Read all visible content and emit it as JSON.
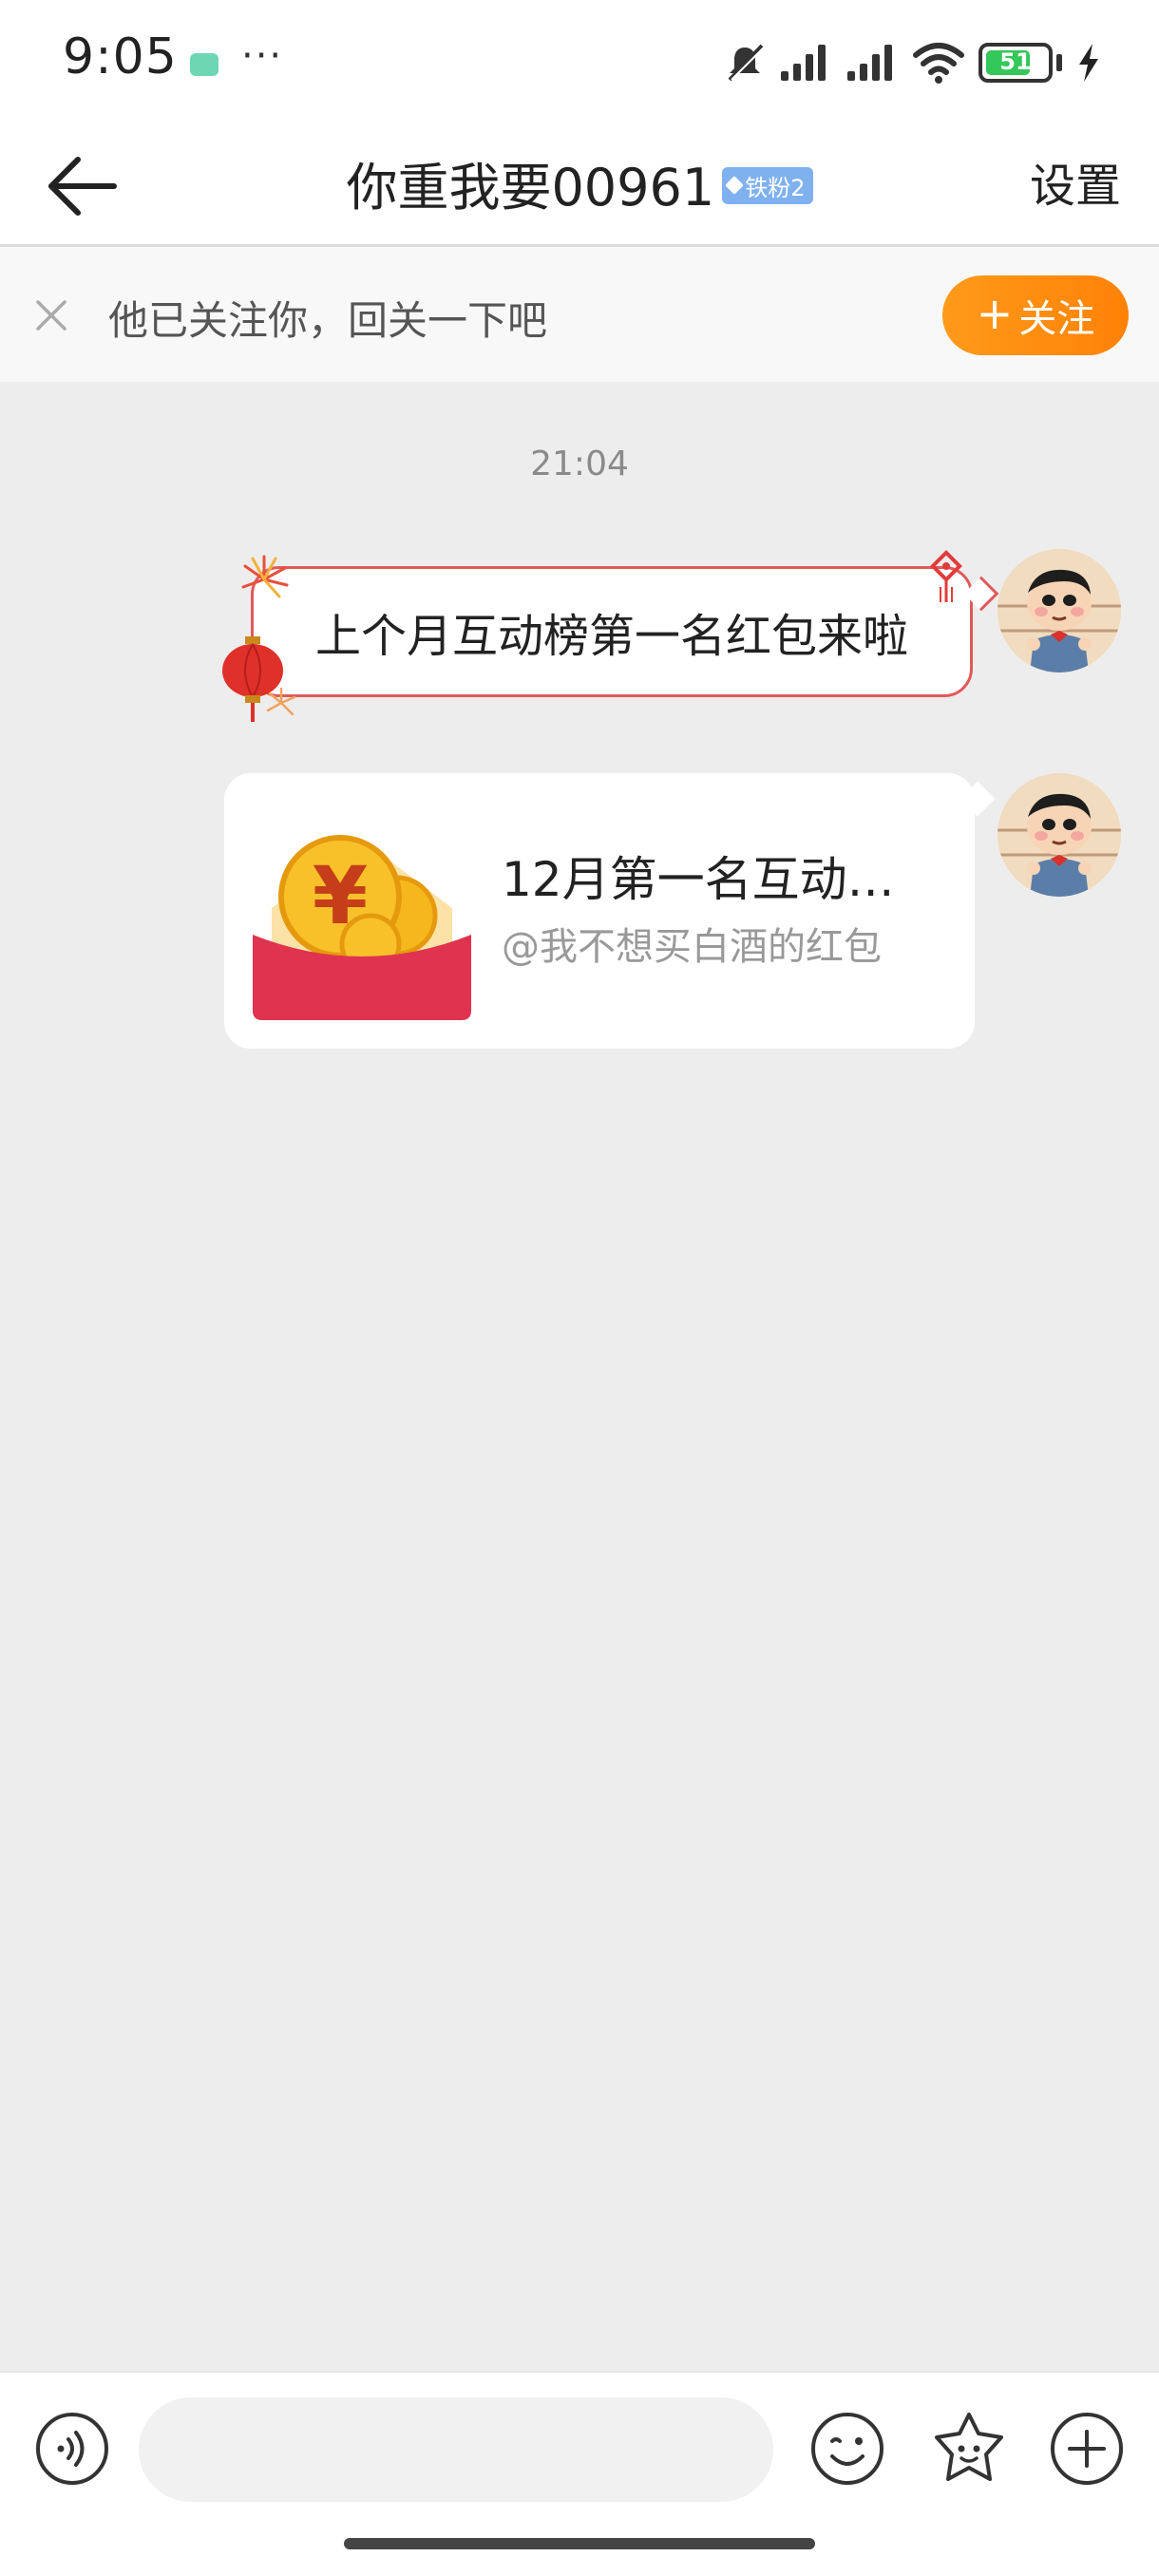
{
  "status_bar": {
    "time": "9:05",
    "more": "···",
    "battery_level": "51",
    "icons": [
      "notification-app-icon",
      "mute-icon",
      "signal-icon",
      "signal-icon",
      "wifi-icon",
      "battery-icon",
      "charging-icon"
    ]
  },
  "header": {
    "title": "你重我要00961",
    "badge": "铁粉2",
    "settings_label": "设置",
    "back_icon": "back-arrow-icon"
  },
  "follow_bar": {
    "text": "他已关注你，回关一下吧",
    "button_label": "关注",
    "button_plus": "+",
    "accent_color": "#ff8a0f"
  },
  "chat": {
    "timestamp": "21:04",
    "messages": [
      {
        "type": "text",
        "text": "上个月互动榜第一名红包来啦"
      },
      {
        "type": "red_packet",
        "title": "12月第一名互动…",
        "subtitle": "@我不想买白酒的红包"
      }
    ]
  },
  "input_bar": {
    "placeholder": "",
    "icons": [
      "voice-icon",
      "emoji-icon",
      "sticker-icon",
      "plus-icon"
    ]
  }
}
